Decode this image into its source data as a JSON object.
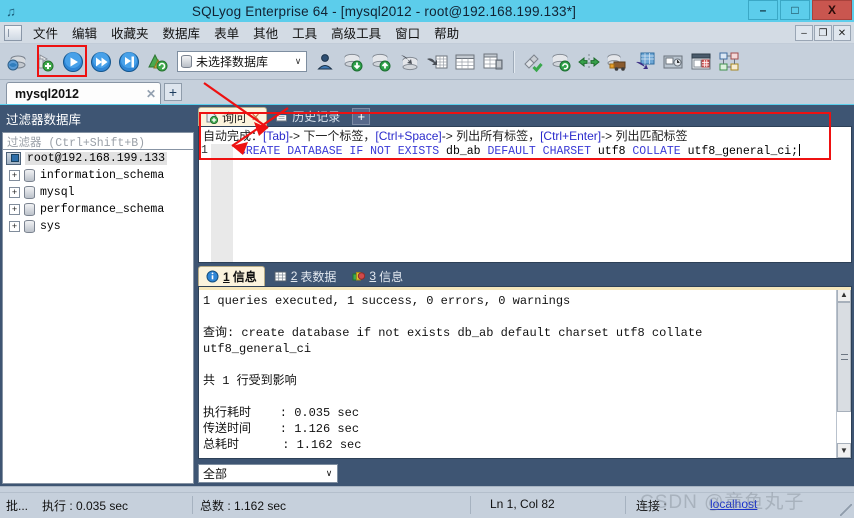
{
  "window": {
    "title": "SQLyog Enterprise 64 - [mysql2012 - root@192.168.199.133*]",
    "app_icon": "sqlyog-icon",
    "minimize_label": "–",
    "maximize_label": "□",
    "close_label": "X"
  },
  "menubar": {
    "doc_icon": "document-icon",
    "items": [
      {
        "label": "文件",
        "name": "menu-file"
      },
      {
        "label": "编辑",
        "name": "menu-edit",
        "marked": true
      },
      {
        "label": "收藏夹",
        "name": "menu-favorites"
      },
      {
        "label": "数据库",
        "name": "menu-database"
      },
      {
        "label": "表单",
        "name": "menu-table"
      },
      {
        "label": "其他",
        "name": "menu-others"
      },
      {
        "label": "工具",
        "name": "menu-tools"
      },
      {
        "label": "高级工具",
        "name": "menu-advanced-tools"
      },
      {
        "label": "窗口",
        "name": "menu-window"
      },
      {
        "label": "帮助",
        "name": "menu-help"
      }
    ],
    "mdi_minimize": "–",
    "mdi_restore": "❐",
    "mdi_close": "✕"
  },
  "toolbar": {
    "db_selector": {
      "value": "未选择数据库",
      "arrow": "∨",
      "icon": "database-cylinder-icon"
    },
    "icons": [
      "new-connection-icon",
      "refresh-object-browser-icon",
      "execute-query-icon",
      "execute-all-queries-icon",
      "execute-current-query-icon",
      "stop-query-icon",
      "user-manager-icon",
      "backup-database-icon",
      "restore-database-icon",
      "import-external-data-icon",
      "export-data-icon",
      "table-data-icon",
      "table-diagnostics-icon",
      "copy-database-icon",
      "sync-database-icon",
      "schema-sync-icon",
      "data-sync-icon",
      "migrate-data-icon",
      "scheduled-backup-icon",
      "notification-services-icon",
      "query-builder-icon",
      "schema-designer-icon"
    ]
  },
  "connection_tabs": {
    "tabs": [
      {
        "label": "mysql2012",
        "close": "✕"
      }
    ],
    "add_label": "+"
  },
  "sidebar": {
    "title": "过滤器数据库",
    "filter_placeholder": "过滤器 (Ctrl+Shift+B)",
    "root": {
      "label": "root@192.168.199.133",
      "icon": "server-icon"
    },
    "databases": [
      {
        "label": "information_schema",
        "expander": "+",
        "icon": "database-icon"
      },
      {
        "label": "mysql",
        "expander": "+",
        "icon": "database-icon"
      },
      {
        "label": "performance_schema",
        "expander": "+",
        "icon": "database-icon"
      },
      {
        "label": "sys",
        "expander": "+",
        "icon": "database-icon"
      }
    ]
  },
  "editor": {
    "tabs": [
      {
        "label": "询问",
        "icon": "query-tab-icon",
        "close": "✕",
        "active": true
      },
      {
        "label": "历史记录",
        "icon": "history-tab-icon",
        "active": false
      }
    ],
    "add_label": "+",
    "hint": {
      "prefix": "自动完成： ",
      "k1": "[Tab]",
      "t1": "-> 下一个标签， ",
      "k2": "[Ctrl+Space]",
      "t2": "-> 列出所有标签， ",
      "k3": "[Ctrl+Enter]",
      "t3": "-> 列出匹配标签"
    },
    "line_number": "1",
    "sql_tokens": [
      {
        "text": "CREATE DATABASE IF NOT EXISTS ",
        "kind": "keyword"
      },
      {
        "text": "db_ab",
        "kind": "identifier"
      },
      {
        "text": " DEFAULT CHARSET ",
        "kind": "keyword"
      },
      {
        "text": "utf8",
        "kind": "identifier"
      },
      {
        "text": " COLLATE ",
        "kind": "keyword"
      },
      {
        "text": "utf8_general_ci;",
        "kind": "identifier"
      }
    ]
  },
  "results": {
    "tabs": [
      {
        "num": "1",
        "label": "信息",
        "icon": "info-tab-icon",
        "active": true
      },
      {
        "num": "2",
        "label": "表数据",
        "icon": "grid-tab-icon",
        "active": false
      },
      {
        "num": "3",
        "label": "信息",
        "icon": "messages-tab-icon",
        "active": false
      }
    ],
    "text": "1 queries executed, 1 success, 0 errors, 0 warnings\n\n查询: create database if not exists db_ab default charset utf8 collate\nutf8_general_ci\n\n共 1 行受到影响\n\n执行耗时    : 0.035 sec\n传送时间    : 1.126 sec\n总耗时      : 1.162 sec",
    "filter": {
      "value": "全部",
      "arrow": "∨"
    },
    "scroll_up": "▲",
    "scroll_down": "▼"
  },
  "statusbar": {
    "batch_label": "批...",
    "exec_label": "执行 : 0.035 sec",
    "total_label": "总数 : 1.162 sec",
    "cursor_label": "Ln 1, Col 82",
    "conn_label": "连接 : ",
    "conn_value": "localhost",
    "resize_grip": "resize-grip-icon"
  },
  "annotations": {
    "watermark": "CSDN @章鱼丸子",
    "highlight_color": "#ee1111"
  }
}
